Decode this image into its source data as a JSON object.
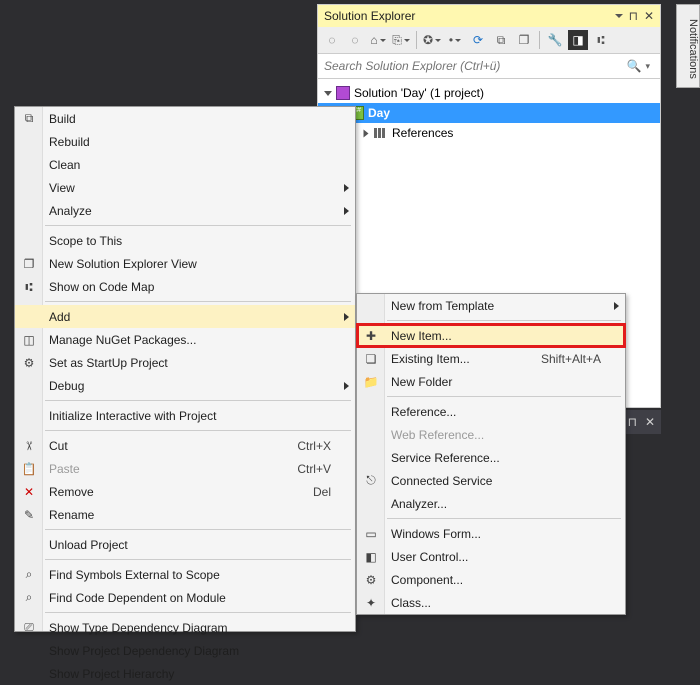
{
  "panel": {
    "title": "Solution Explorer",
    "search_placeholder": "Search Solution Explorer (Ctrl+ü)",
    "tree": {
      "solution": "Solution 'Day' (1 project)",
      "project": "Day",
      "references": "References"
    }
  },
  "side_tab": "Notifications",
  "main_menu": [
    {
      "label": "Build",
      "icon": "build"
    },
    {
      "label": "Rebuild"
    },
    {
      "label": "Clean"
    },
    {
      "label": "View",
      "submenu": true
    },
    {
      "label": "Analyze",
      "submenu": true
    },
    {
      "sep": true
    },
    {
      "label": "Scope to This"
    },
    {
      "label": "New Solution Explorer View",
      "icon": "new-view"
    },
    {
      "label": "Show on Code Map",
      "icon": "code-map"
    },
    {
      "sep": true
    },
    {
      "label": "Add",
      "submenu": true,
      "hover": true
    },
    {
      "label": "Manage NuGet Packages...",
      "icon": "nuget"
    },
    {
      "label": "Set as StartUp Project",
      "icon": "gear"
    },
    {
      "label": "Debug",
      "submenu": true
    },
    {
      "sep": true
    },
    {
      "label": "Initialize Interactive with Project"
    },
    {
      "sep": true
    },
    {
      "label": "Cut",
      "icon": "cut",
      "shortcut": "Ctrl+X"
    },
    {
      "label": "Paste",
      "icon": "paste",
      "shortcut": "Ctrl+V",
      "disabled": true
    },
    {
      "label": "Remove",
      "icon": "remove",
      "shortcut": "Del"
    },
    {
      "label": "Rename",
      "icon": "rename"
    },
    {
      "sep": true
    },
    {
      "label": "Unload Project"
    },
    {
      "sep": true
    },
    {
      "label": "Find Symbols External to Scope",
      "icon": "find-ext"
    },
    {
      "label": "Find Code Dependent on Module",
      "icon": "find-dep"
    },
    {
      "sep": true
    },
    {
      "label": "Show Type Dependency Diagram",
      "icon": "type-dep"
    },
    {
      "label": "Show Project Dependency Diagram"
    },
    {
      "label": "Show Project Hierarchy"
    }
  ],
  "sub_menu": [
    {
      "label": "New from Template",
      "submenu": true
    },
    {
      "sep": true
    },
    {
      "label": "New Item...",
      "icon": "new-item",
      "hover": true,
      "boxed": true
    },
    {
      "label": "Existing Item...",
      "icon": "existing-item",
      "shortcut": "Shift+Alt+A"
    },
    {
      "label": "New Folder",
      "icon": "new-folder"
    },
    {
      "sep": true
    },
    {
      "label": "Reference..."
    },
    {
      "label": "Web Reference...",
      "disabled": true
    },
    {
      "label": "Service Reference..."
    },
    {
      "label": "Connected Service",
      "icon": "connected"
    },
    {
      "label": "Analyzer..."
    },
    {
      "sep": true
    },
    {
      "label": "Windows Form...",
      "icon": "form"
    },
    {
      "label": "User Control...",
      "icon": "control"
    },
    {
      "label": "Component...",
      "icon": "component"
    },
    {
      "label": "Class...",
      "icon": "class"
    }
  ],
  "icon_glyphs": {
    "build": "⧉",
    "new-view": "❐",
    "code-map": "⑆",
    "nuget": "◫",
    "gear": "⚙",
    "cut": "✂",
    "paste": "📋",
    "remove": "✕",
    "rename": "✎",
    "find-ext": "⌕",
    "find-dep": "⌕",
    "type-dep": "⎚",
    "new-item": "✚",
    "existing-item": "❏",
    "new-folder": "📁",
    "connected": "⎋",
    "form": "▭",
    "control": "◧",
    "component": "⚙",
    "class": "✦",
    "search": "🔍",
    "back": "⟵",
    "fwd": "⟶",
    "home": "⌂",
    "refresh": "⟳",
    "collapse": "⊟",
    "props": "🔧",
    "showall": "◨",
    "preview": "◩",
    "pin": "📌",
    "close": "✕"
  }
}
